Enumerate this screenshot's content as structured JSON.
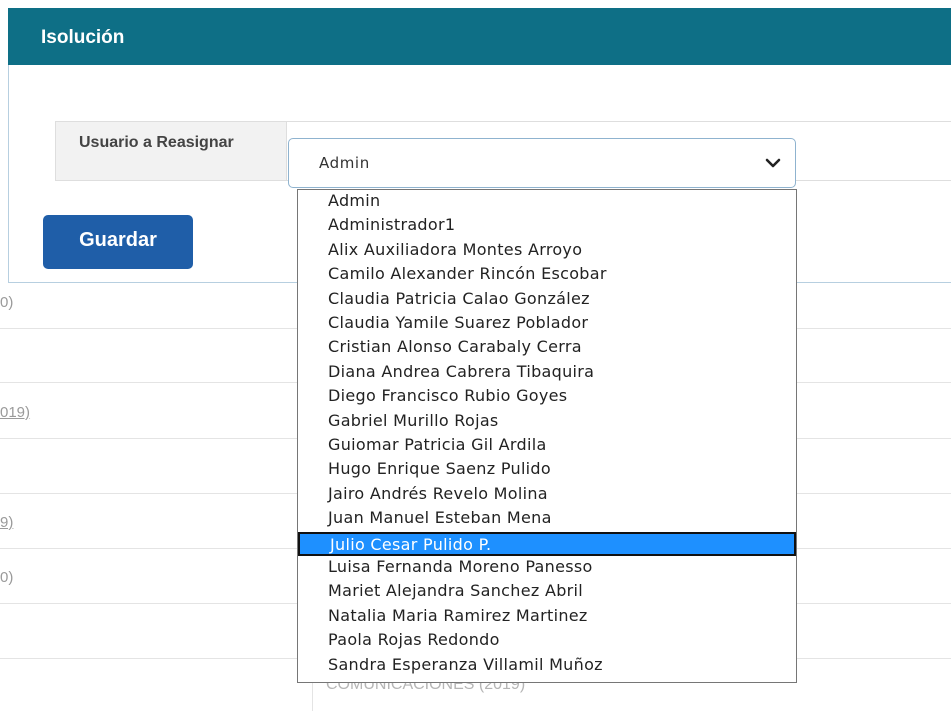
{
  "background": {
    "fragments": [
      "0)",
      "",
      "019)",
      "",
      "9)",
      "0)",
      "",
      ""
    ],
    "bottom_text": "COMUNICACIONES (2019)"
  },
  "modal": {
    "title": "Isolución",
    "field_label": "Usuario a Reasignar",
    "select_value": "Admin",
    "save_label": "Guardar"
  },
  "dropdown": {
    "options": [
      "Admin",
      "Administrador1",
      "Alix Auxiliadora Montes Arroyo",
      "Camilo Alexander Rincón Escobar",
      "Claudia Patricia Calao González",
      "Claudia Yamile Suarez Poblador",
      "Cristian Alonso Carabaly Cerra",
      "Diana Andrea Cabrera Tibaquira",
      "Diego Francisco Rubio Goyes",
      "Gabriel Murillo Rojas",
      "Guiomar Patricia Gil Ardila",
      "Hugo Enrique Saenz Pulido",
      "Jairo Andrés Revelo Molina",
      "Juan Manuel Esteban Mena",
      "Julio Cesar Pulido P.",
      "Luisa Fernanda Moreno Panesso",
      "Mariet Alejandra Sanchez Abril",
      "Natalia Maria Ramirez Martinez",
      "Paola Rojas Redondo",
      "Sandra Esperanza Villamil Muñoz"
    ],
    "selected_index": 14
  },
  "colors": {
    "header": "#0e6f86",
    "save_button": "#1f5ea8",
    "selected_option": "#1e90ff"
  }
}
